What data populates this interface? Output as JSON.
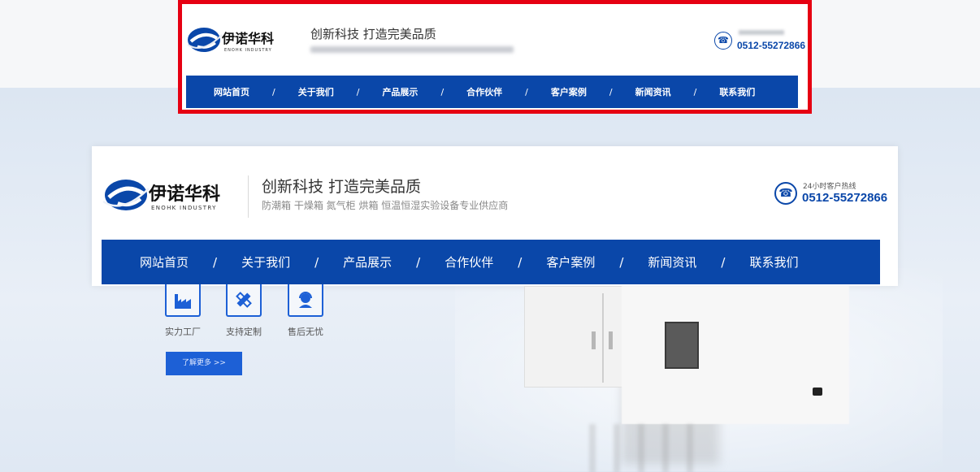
{
  "brand": {
    "name": "伊诺华科",
    "name_en": "ENOHK INDUSTRY",
    "accent_color": "#0a47a9",
    "highlight_color": "#e60012"
  },
  "header": {
    "slogan": "创新科技 打造完美品质",
    "subtitle": "防潮箱 干燥箱 氮气柜 烘箱 恒温恒湿实验设备专业供应商",
    "hotline_label": "24小时客户热线",
    "phone": "0512-55272866",
    "phone_icon": "phone-icon"
  },
  "nav": {
    "items": [
      {
        "label": "网站首页"
      },
      {
        "label": "关于我们"
      },
      {
        "label": "产品展示"
      },
      {
        "label": "合作伙伴"
      },
      {
        "label": "客户案例"
      },
      {
        "label": "新闻资讯"
      },
      {
        "label": "联系我们"
      }
    ],
    "separator": "/"
  },
  "features": [
    {
      "label": "实力工厂",
      "icon": "factory-icon"
    },
    {
      "label": "支持定制",
      "icon": "pencil-ruler-icon"
    },
    {
      "label": "售后无忧",
      "icon": "support-agent-icon"
    }
  ],
  "more_button": {
    "label": "了解更多 >>"
  }
}
